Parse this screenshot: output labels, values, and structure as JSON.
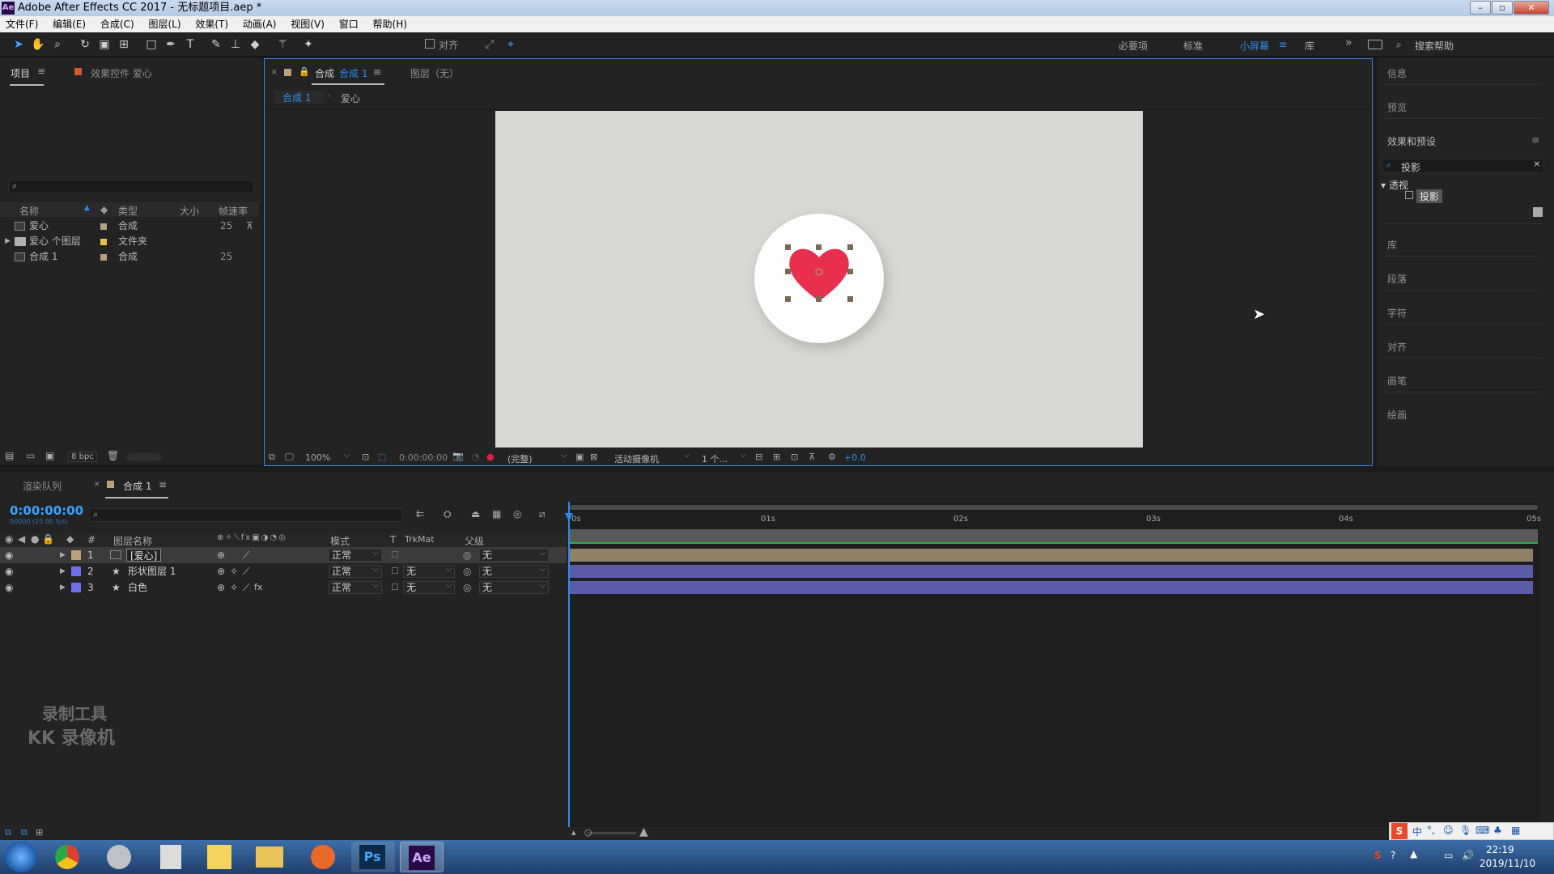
{
  "window": {
    "title": "Adobe After Effects CC 2017 - 无标题项目.aep *",
    "icon": "ae-icon"
  },
  "menu": [
    "文件(F)",
    "编辑(E)",
    "合成(C)",
    "图层(L)",
    "效果(T)",
    "动画(A)",
    "视图(V)",
    "窗口",
    "帮助(H)"
  ],
  "toolbar": {
    "align_label": "对齐"
  },
  "workspaces": {
    "essentials": "必要项",
    "standard": "标准",
    "small_screen": "小屏幕",
    "library": "库",
    "search_help": "搜索帮助"
  },
  "project_panel": {
    "tab": "项目",
    "effects_tab": "效果控件 爱心",
    "columns": {
      "name": "名称",
      "type": "类型",
      "size": "大小",
      "fps": "帧速率"
    },
    "items": [
      {
        "name": "爱心",
        "type": "合成",
        "fps": "25",
        "color": "#b8a27a"
      },
      {
        "name": "爱心 个图层",
        "type": "文件夹",
        "fps": "",
        "color": "#e8c14a"
      },
      {
        "name": "合成 1",
        "type": "合成",
        "fps": "25",
        "color": "#b8a27a"
      }
    ],
    "bpc": "8 bpc"
  },
  "composition_panel": {
    "tab_prefix": "合成",
    "tab_name": "合成 1",
    "layer_tab": "图层（无）",
    "breadcrumb": [
      "合成 1",
      "爱心"
    ],
    "zoom": "100%",
    "timecode": "0:00:00:00",
    "resolution": "(完整)",
    "camera": "活动摄像机",
    "views": "1 个...",
    "exposure": "+0.0"
  },
  "right_panel": {
    "info": "信息",
    "preview": "预览",
    "effects_presets": "效果和预设",
    "search_value": "投影",
    "tree_folder": "透视",
    "tree_item": "投影",
    "library": "库",
    "paragraph": "段落",
    "character": "字符",
    "align": "对齐",
    "brushes": "画笔",
    "paint": "绘画"
  },
  "timeline": {
    "render_queue_tab": "渲染队列",
    "comp_tab": "合成 1",
    "timecode": "0:00:00:00",
    "frame_info": "00000 (25.00 fps)",
    "columns": {
      "num": "#",
      "layer_name": "图层名称",
      "mode": "模式",
      "t": "T",
      "trkmat": "TrkMat",
      "parent": "父级"
    },
    "ruler": [
      "0s",
      "01s",
      "02s",
      "03s",
      "04s",
      "05s"
    ],
    "layers": [
      {
        "num": "1",
        "name": "[爱心]",
        "mode": "正常",
        "trkmat": "",
        "parent": "无",
        "label_color": "#b8a27a",
        "bar_color": "#8f8068"
      },
      {
        "num": "2",
        "name": "形状图层 1",
        "mode": "正常",
        "trkmat": "无",
        "parent": "无",
        "label_color": "#6e6ee6",
        "bar_color": "#5b5ba8"
      },
      {
        "num": "3",
        "name": "白色",
        "mode": "正常",
        "trkmat": "无",
        "parent": "无",
        "label_color": "#6e6ee6",
        "bar_color": "#5b5ba8"
      }
    ]
  },
  "watermark": {
    "line1": "录制工具",
    "line2": "KK 录像机"
  },
  "taskbar": {
    "time": "22:19",
    "date": "2019/11/10",
    "ime": "中",
    "ps": "Ps",
    "ae": "Ae"
  },
  "colors": {
    "accent": "#2d8ceb",
    "heart": "#e8304e",
    "canvas": "#d8d8d6",
    "timecode": "#3aa2ff"
  }
}
